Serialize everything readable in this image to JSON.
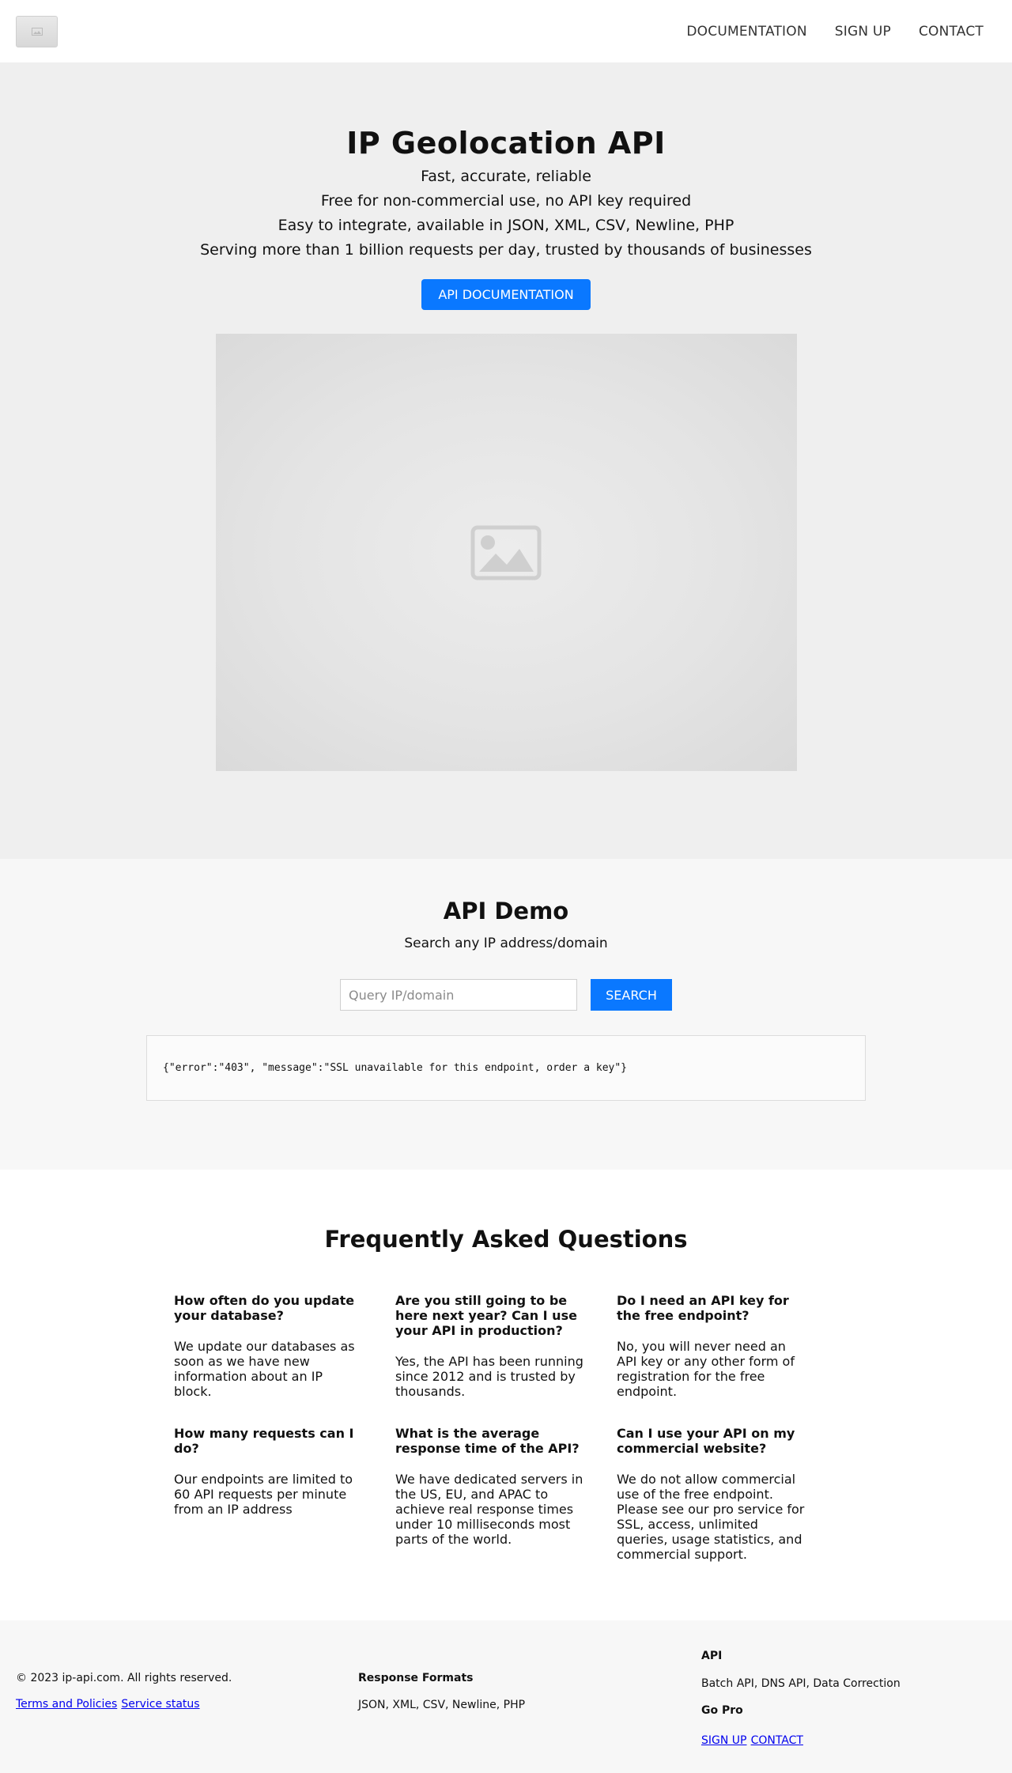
{
  "header": {
    "nav": [
      {
        "label": "DOCUMENTATION"
      },
      {
        "label": "SIGN UP"
      },
      {
        "label": "CONTACT"
      }
    ]
  },
  "hero": {
    "title": "IP Geolocation API",
    "lines": [
      "Fast, accurate, reliable",
      "Free for non-commercial use, no API key required",
      "Easy to integrate, available in JSON, XML, CSV, Newline, PHP",
      "Serving more than 1 billion requests per day, trusted by thousands of businesses"
    ],
    "button_label": "API DOCUMENTATION",
    "image_icon": "image-placeholder-icon"
  },
  "demo": {
    "title": "API Demo",
    "subtitle": "Search any IP address/domain",
    "input_placeholder": "Query IP/domain",
    "input_value": "",
    "search_label": "SEARCH",
    "result": "{\"error\":\"403\", \"message\":\"SSL unavailable for this endpoint, order a key\"}"
  },
  "faq": {
    "title": "Frequently Asked Questions",
    "items": [
      {
        "q": "How often do you update your database?",
        "a": "We update our databases as soon as we have new information about an IP block."
      },
      {
        "q": "Are you still going to be here next year? Can I use your API in production?",
        "a": "Yes, the API has been running since 2012 and is trusted by thousands."
      },
      {
        "q": "Do I need an API key for the free endpoint?",
        "a": "No, you will never need an API key or any other form of registration for the free endpoint."
      },
      {
        "q": "How many requests can I do?",
        "a": "Our endpoints are limited to 60 API requests per minute from an IP address"
      },
      {
        "q": "What is the average response time of the API?",
        "a": "We have dedicated servers in the US, EU, and APAC to achieve real response times under 10 milliseconds most parts of the world."
      },
      {
        "q": "Can I use your API on my commercial website?",
        "a": "We do not allow commercial use of the free endpoint. Please see our pro service for SSL, access, unlimited queries, usage statistics, and commercial support."
      }
    ]
  },
  "footer": {
    "copyright": "© 2023 ip-api.com. All rights reserved.",
    "links_left": [
      "Terms and Policies",
      "Service status"
    ],
    "formats_title": "Response Formats",
    "formats_text": "JSON, XML, CSV, Newline, PHP",
    "api_title": "API",
    "api_text": "Batch API, DNS API, Data Correction",
    "pro_title": "Go Pro",
    "pro_links": [
      "SIGN UP",
      "CONTACT"
    ]
  },
  "colors": {
    "accent": "#0a78ff",
    "hero_bg": "#efefef",
    "section_bg": "#f7f7f7",
    "link": "#0000ee"
  }
}
